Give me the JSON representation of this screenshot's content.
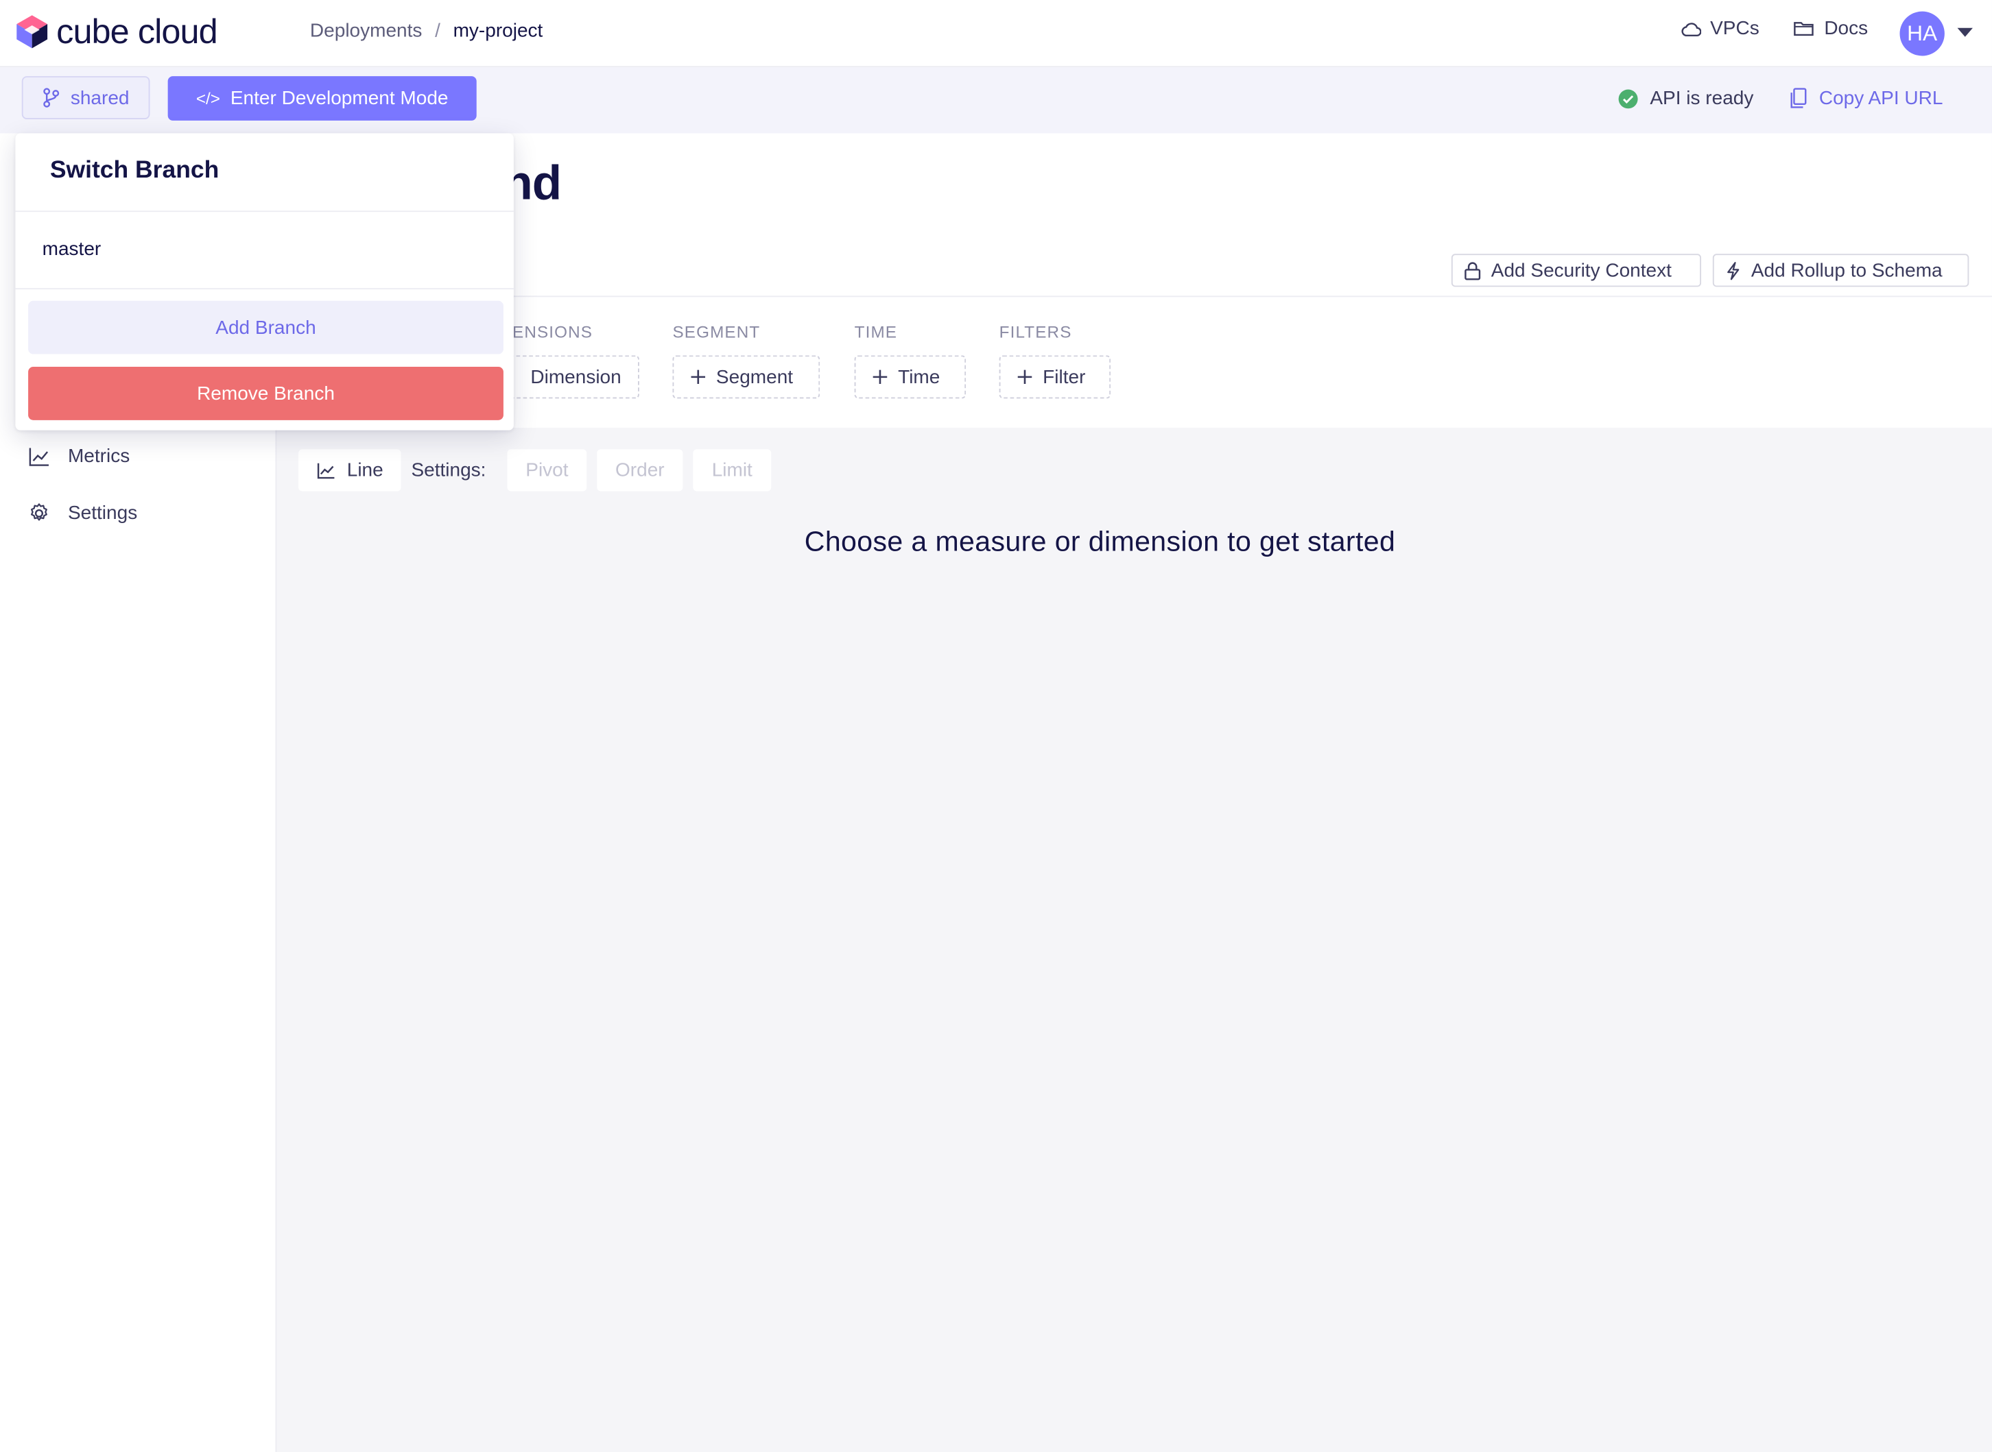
{
  "app": {
    "brand": "cube cloud",
    "breadcrumb": {
      "root": "Deployments",
      "separator": "/",
      "current": "my-project"
    },
    "nav": {
      "vpcs": "VPCs",
      "docs": "Docs"
    },
    "user": {
      "initials": "HA"
    }
  },
  "toolbar": {
    "branch_label": "shared",
    "dev_mode_icon": "</>",
    "dev_mode_label": "Enter Development Mode",
    "api_status": "API is ready",
    "copy_api_label": "Copy API URL"
  },
  "sidebar": {
    "items": [
      {
        "label": "Metrics",
        "icon": "chart-line-icon"
      },
      {
        "label": "Settings",
        "icon": "gear-icon"
      }
    ]
  },
  "main": {
    "title_visible": "und",
    "actions": {
      "security": "Add Security Context",
      "rollup": "Add Rollup to Schema"
    },
    "query": {
      "dimensions": {
        "label": "ENSIONS",
        "button": "Dimension"
      },
      "segment": {
        "label": "SEGMENT",
        "button": "Segment"
      },
      "time": {
        "label": "TIME",
        "button": "Time"
      },
      "filters": {
        "label": "FILTERS",
        "button": "Filter"
      }
    },
    "settings_row": {
      "chart_type": "Line",
      "settings_label": "Settings:",
      "pivot": "Pivot",
      "order": "Order",
      "limit": "Limit"
    },
    "empty_message": "Choose a measure or dimension to get started"
  },
  "branch_popover": {
    "title": "Switch Branch",
    "branches": [
      "master"
    ],
    "add_label": "Add Branch",
    "remove_label": "Remove Branch"
  },
  "colors": {
    "accent": "#7a77ff",
    "danger": "#ee6f71",
    "success": "#4caf6e",
    "text": "#141446"
  }
}
